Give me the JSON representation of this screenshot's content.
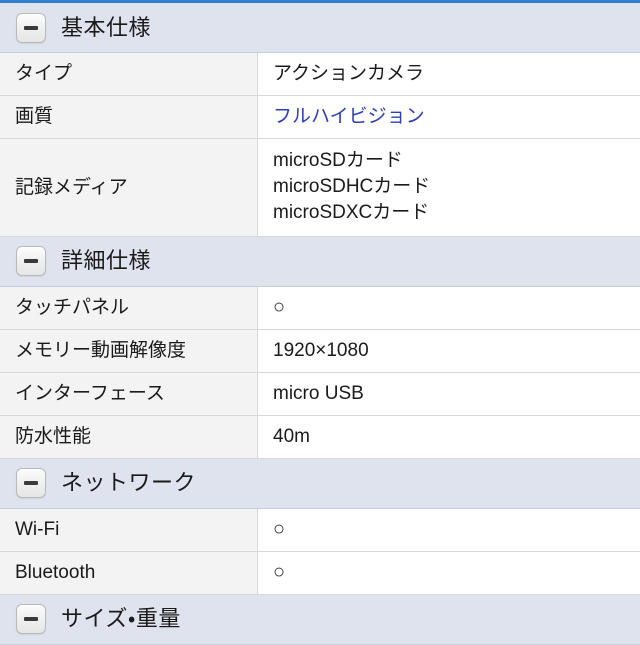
{
  "theme": {
    "top_border_color": "#2f7fd0",
    "section_band_color": "#dfe3ee",
    "label_cell_color": "#f3f3f3",
    "link_color": "#2d3fb8",
    "text_color": "#1a1a1a"
  },
  "icons": {
    "collapse": "minus-icon",
    "circle_mark": "○"
  },
  "sections": [
    {
      "id": "basic-spec",
      "title": "基本仕様",
      "toggle_state": "expanded",
      "rows": [
        {
          "label": "タイプ",
          "value": "アクションカメラ",
          "style": "text"
        },
        {
          "label": "画質",
          "value": "フルハイビジョン",
          "style": "link"
        },
        {
          "label": "記録メディア",
          "value": "microSDカード\nmicroSDHCカード\nmicroSDXCカード",
          "style": "multiline"
        }
      ]
    },
    {
      "id": "detail-spec",
      "title": "詳細仕様",
      "toggle_state": "expanded",
      "rows": [
        {
          "label": "タッチパネル",
          "value": "○",
          "style": "mark"
        },
        {
          "label": "メモリー動画解像度",
          "value": "1920×1080",
          "style": "text"
        },
        {
          "label": "インターフェース",
          "value": "micro USB",
          "style": "text"
        },
        {
          "label": "防水性能",
          "value": "40m",
          "style": "text"
        }
      ]
    },
    {
      "id": "network",
      "title": "ネットワーク",
      "toggle_state": "expanded",
      "rows": [
        {
          "label": "Wi-Fi",
          "value": "○",
          "style": "mark"
        },
        {
          "label": "Bluetooth",
          "value": "○",
          "style": "mark"
        }
      ]
    },
    {
      "id": "size-weight",
      "title": "サイズ・重量",
      "toggle_state": "expanded",
      "rows": []
    }
  ]
}
